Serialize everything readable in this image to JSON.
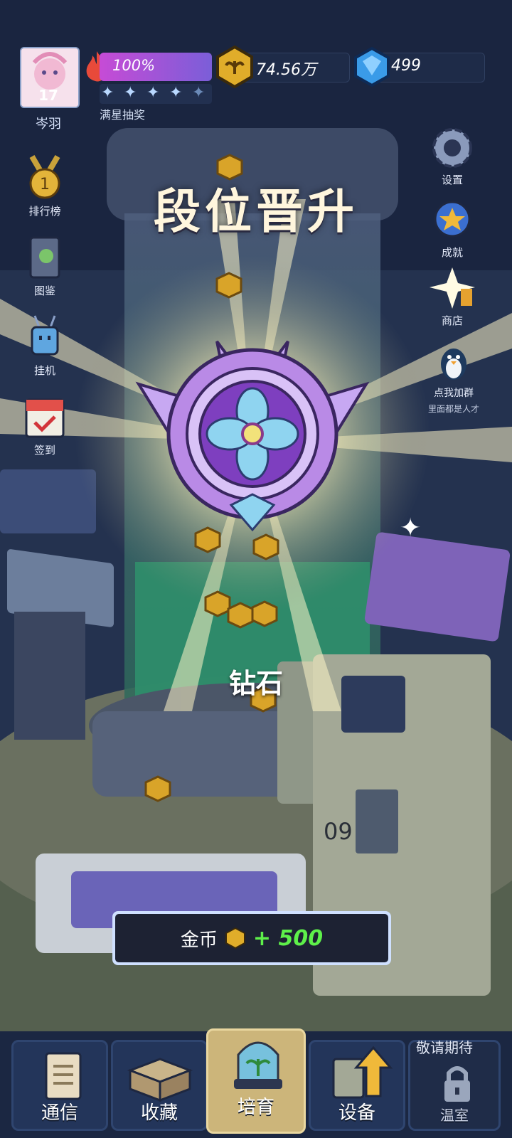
{
  "hud": {
    "player_level": "17",
    "player_name": "岑羽",
    "energy_percent": "100%",
    "energy_fill": 1.0,
    "star_rating": 5,
    "star_label": "满星抽奖",
    "gold_amount": "74.56万",
    "gem_amount": "499"
  },
  "sidebar_left": [
    {
      "label": "排行榜",
      "icon": "medal-icon"
    },
    {
      "label": "图鉴",
      "icon": "book-icon"
    },
    {
      "label": "挂机",
      "icon": "robot-icon"
    },
    {
      "label": "签到",
      "icon": "calendar-check-icon"
    }
  ],
  "sidebar_right": [
    {
      "label": "设置",
      "icon": "gear-icon"
    },
    {
      "label": "成就",
      "icon": "achievement-icon"
    },
    {
      "label": "商店",
      "icon": "shop-icon"
    },
    {
      "label": "点我加群",
      "sub": "里面都是人才",
      "icon": "penguin-icon"
    }
  ],
  "popup": {
    "title": "段位晋升",
    "rank_name": "钻石",
    "reward_label": "金币",
    "reward_amount": "+ 500"
  },
  "bottom_nav": {
    "coming_soon": "敬请期待",
    "tabs": [
      {
        "label": "通信",
        "icon": "document-icon"
      },
      {
        "label": "收藏",
        "icon": "box-icon"
      },
      {
        "label": "培育",
        "icon": "sprout-dome-icon"
      },
      {
        "label": "设备",
        "icon": "upgrade-arrow-icon"
      },
      {
        "label": "温室",
        "icon": "lock-icon"
      }
    ]
  },
  "colors": {
    "reward_amount": "#5ef04a",
    "energy_bar": "#c64bd6",
    "background": "#1c2846"
  }
}
